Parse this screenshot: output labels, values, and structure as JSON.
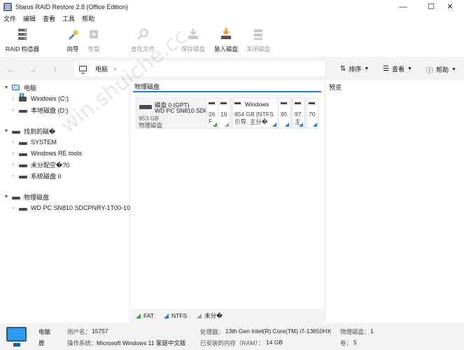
{
  "window": {
    "title": "Starus RAID Restore 2.8 (Office Edition)",
    "controls": {
      "minimize": "—",
      "maximize": "☐",
      "close": "✕"
    }
  },
  "menu": [
    "文件",
    "编辑",
    "查看",
    "工具",
    "帮助"
  ],
  "toolbar": {
    "raid_builder": "RAID 构造器",
    "wizard": "向导",
    "recover": "恢复",
    "find_file": "查找文件",
    "save_disk": "保存磁盘",
    "load_disk": "装入磁盘",
    "close_disk": "关闭磁盘"
  },
  "nav": {
    "back": "←",
    "forward": "→",
    "up": "↑",
    "breadcrumb": "电脑",
    "sort": "排序",
    "view": "查看",
    "help": "帮助"
  },
  "tree": {
    "computer": {
      "label": "电脑",
      "children": [
        "Windows (C:)",
        "本地磁盘 (D:)"
      ]
    },
    "found": {
      "label": "找到的磁�",
      "children": [
        "SYSTEM",
        "Windows RE tools",
        "未分配空�?0",
        "系统磁盘 0"
      ]
    },
    "physical": {
      "label": "物理磁盘",
      "children": [
        "WD PC SN810 SDCPNRY-1T00-1006"
      ]
    }
  },
  "center": {
    "tab": "物理磁盘",
    "disk": {
      "name": "磁盘 0 (GPT)",
      "model": "WD PC SN810 SDC",
      "size": "953 GB",
      "kind": "物理磁盘"
    },
    "partitions": [
      {
        "size": "26",
        "type": "F",
        "corner": "#3aa340"
      },
      {
        "size": "16",
        "type": "",
        "corner": "#9a9a9a"
      },
      {
        "name": "Windows",
        "size": "854 GB [NTFS",
        "type": "引导, 主分�",
        "corner": "#2b7cd3"
      },
      {
        "size": "95",
        "type": "",
        "corner": "#2b7cd3"
      },
      {
        "size": "97.",
        "type": "主",
        "corner": "#2b7cd3"
      },
      {
        "size": "70",
        "type": "",
        "corner": "#2b7cd3"
      }
    ],
    "legend": [
      {
        "label": "FAT",
        "color": "#3aa340"
      },
      {
        "label": "NTFS",
        "color": "#2b7cd3"
      },
      {
        "label": "未分�",
        "color": "#9a9a9a"
      }
    ]
  },
  "preview": {
    "title": "预览"
  },
  "status": {
    "name": "电脑",
    "sub": "鹿",
    "user_label": "用户名：",
    "user": "15757",
    "os_label": "操作系统：",
    "os": "Microsoft Windows 11 家庭中文版",
    "cpu_label": "处理器：",
    "cpu": "13th Gen Intel(R) Core(TM) i7-13650HX",
    "ram_label": "已安装的内存（RAM）：",
    "ram": "14 GB",
    "disks_label": "物理磁盘：",
    "disks": "1",
    "volumes_label": "卷：",
    "volumes": "5"
  },
  "watermark": "win.shuiche.cc"
}
